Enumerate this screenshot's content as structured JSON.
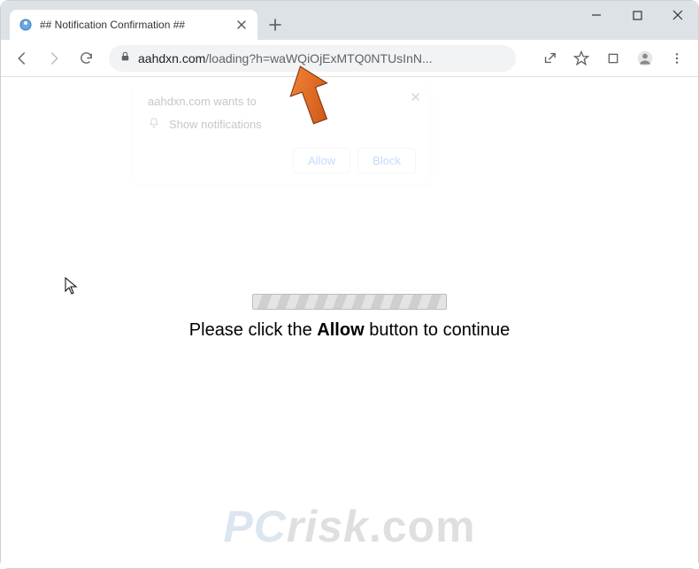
{
  "window": {
    "minimize": "–",
    "maximize": "☐",
    "close": "✕"
  },
  "tab": {
    "title": "## Notification Confirmation ##"
  },
  "address": {
    "domain": "aahdxn.com",
    "path": "/loading?h=waWQiOjExMTQ0NTUsInN..."
  },
  "permission": {
    "origin": "aahdxn.com wants to",
    "action_label": "Show notifications",
    "allow": "Allow",
    "block": "Block"
  },
  "page": {
    "prefix": "Please click the ",
    "bold": "Allow",
    "suffix": " button to continue"
  },
  "watermark": {
    "pc": "PC",
    "risk": "risk",
    "com": ".com"
  }
}
